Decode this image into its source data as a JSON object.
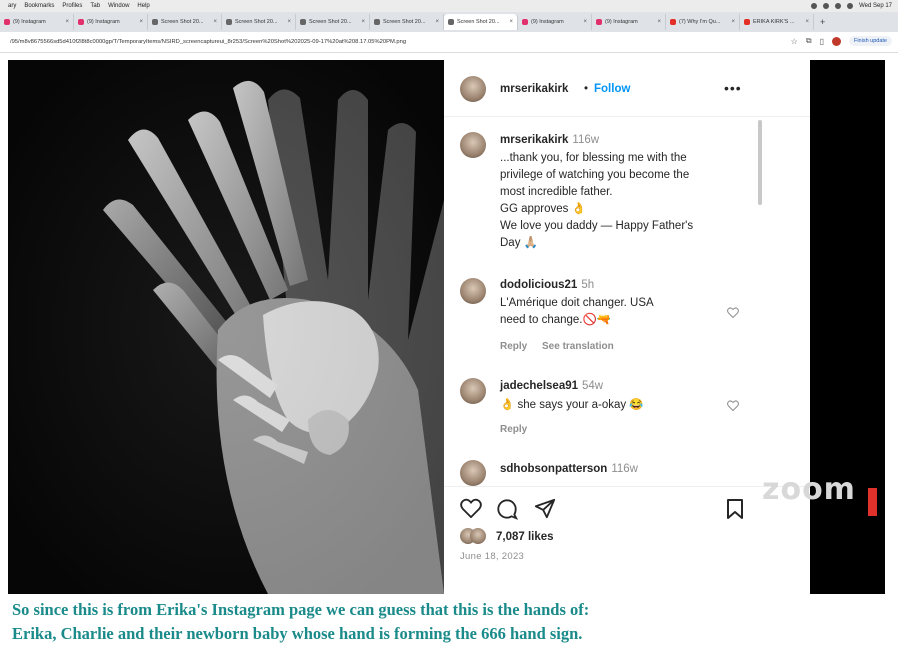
{
  "menubar": {
    "items": [
      "ary",
      "Bookmarks",
      "Profiles",
      "Tab",
      "Window",
      "Help"
    ],
    "clock": "Wed Sep 17"
  },
  "tabs": [
    {
      "label": "(9) Instagram",
      "color": "#e1306c"
    },
    {
      "label": "(9) Instagram",
      "color": "#e1306c"
    },
    {
      "label": "Screen Shot 20...",
      "color": "#666666"
    },
    {
      "label": "Screen Shot 20...",
      "color": "#666666"
    },
    {
      "label": "Screen Shot 20...",
      "color": "#666666"
    },
    {
      "label": "Screen Shot 20...",
      "color": "#666666"
    },
    {
      "label": "Screen Shot 20...",
      "color": "#666666"
    },
    {
      "label": "(9) Instagram",
      "color": "#e1306c"
    },
    {
      "label": "(9) Instagram",
      "color": "#e1306c"
    },
    {
      "label": "(7) Why I'm Qu...",
      "color": "#e52d27"
    },
    {
      "label": "ERIKA KIRK'S ...",
      "color": "#e52d27"
    }
  ],
  "address": {
    "url": "/95/m8v8675566sd5d410f2l8t8c0000gp/T/TemporaryItems/NSIRD_screencaptureui_8r253/Screen%20Shot%202025-09-17%20at%208.17.05%20PM.png",
    "finish_update": "Finish update"
  },
  "post": {
    "username": "mrserikakirk",
    "follow": "Follow",
    "more": "•••",
    "comments": [
      {
        "user": "mrserikakirk",
        "time": "116w",
        "lines": [
          "...thank you, for blessing me with the",
          "privilege of watching you become the",
          "most incredible father.",
          "GG approves 👌",
          "We love you daddy — Happy Father's",
          "Day 🙏🏼"
        ]
      },
      {
        "user": "dodolicious21",
        "time": "5h",
        "lines": [
          "L'Amérique doit changer. USA",
          "need to change.🚫🔫"
        ],
        "reply": "Reply",
        "translate": "See translation"
      },
      {
        "user": "jadechelsea91",
        "time": "54w",
        "lines": [
          "👌 she says your a-okay 😂"
        ],
        "reply": "Reply"
      },
      {
        "user": "sdhobsonpatterson",
        "time": "116w",
        "lines": []
      }
    ],
    "likes": "7,087 likes",
    "date": "June 18, 2023"
  },
  "zoom_logo": "zoom",
  "caption": {
    "line1": "So since this is from Erika's Instagram page we can guess that this is the hands of:",
    "line2": "Erika, Charlie and their newborn baby whose hand is forming the 666 hand sign."
  }
}
